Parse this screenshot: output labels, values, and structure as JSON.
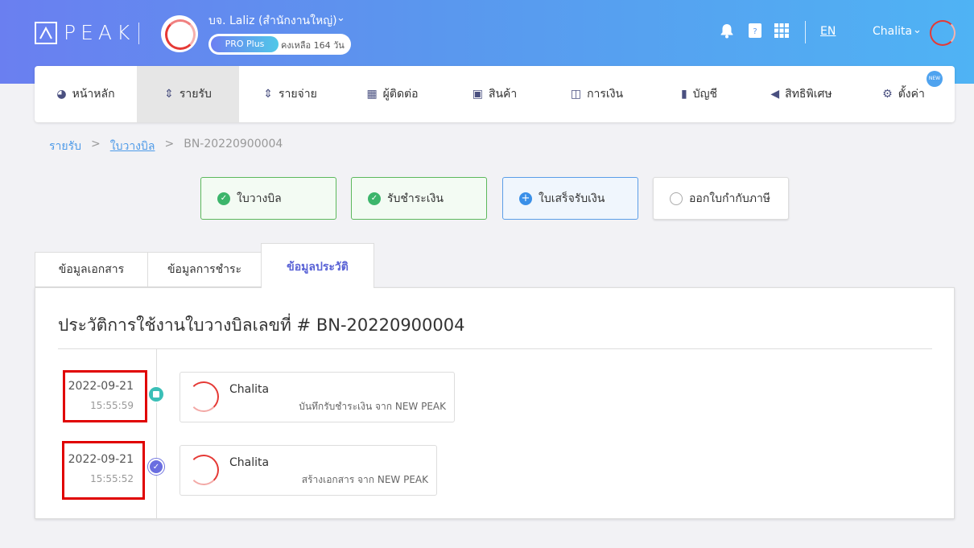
{
  "brand": {
    "logo_text": "PEAK"
  },
  "company": {
    "name": "บจ. Laliz (สำนักงานใหญ่)",
    "plan": "PRO Plus",
    "remaining": "คงเหลือ 164 วัน"
  },
  "header": {
    "language": "EN",
    "user_name": "Chalita"
  },
  "icons": {
    "notification": "bell-icon",
    "help": "book-icon",
    "apps": "grid-icon",
    "chevron": "chevron-down-icon"
  },
  "nav": {
    "items": [
      {
        "label": "หน้าหลัก",
        "icon": "dashboard-icon"
      },
      {
        "label": "รายรับ",
        "icon": "income-icon",
        "active": true
      },
      {
        "label": "รายจ่าย",
        "icon": "expense-icon"
      },
      {
        "label": "ผู้ติดต่อ",
        "icon": "building-icon"
      },
      {
        "label": "สินค้า",
        "icon": "box-icon"
      },
      {
        "label": "การเงิน",
        "icon": "money-icon"
      },
      {
        "label": "บัญชี",
        "icon": "ledger-icon"
      },
      {
        "label": "สิทธิพิเศษ",
        "icon": "megaphone-icon"
      },
      {
        "label": "ตั้งค่า",
        "icon": "gear-icon"
      }
    ],
    "new_badge": "NEW"
  },
  "breadcrumb": {
    "items": [
      "รายรับ",
      "ใบวางบิล",
      "BN-20220900004"
    ],
    "separator": ">"
  },
  "workflow": {
    "steps": [
      {
        "label": "ใบวางบิล",
        "status": "done"
      },
      {
        "label": "รับชำระเงิน",
        "status": "done"
      },
      {
        "label": "ใบเสร็จรับเงิน",
        "status": "current"
      },
      {
        "label": "ออกใบกำกับภาษี",
        "status": "todo"
      }
    ]
  },
  "tabs": [
    {
      "label": "ข้อมูลเอกสาร"
    },
    {
      "label": "ข้อมูลการชำระ"
    },
    {
      "label": "ข้อมูลประวัติ",
      "active": true
    }
  ],
  "history": {
    "title": "ประวัติการใช้งานใบวางบิลเลขที่ # BN-20220900004",
    "entries": [
      {
        "date": "2022-09-21",
        "time": "15:55:59",
        "user": "Chalita",
        "action": "บันทึกรับชำระเงิน จาก NEW PEAK",
        "marker": "teal"
      },
      {
        "date": "2022-09-21",
        "time": "15:55:52",
        "user": "Chalita",
        "action": "สร้างเอกสาร จาก NEW PEAK",
        "marker": "purple"
      }
    ]
  },
  "colors": {
    "brand_gradient_start": "#6a7ff0",
    "brand_gradient_end": "#4fb3f4",
    "active_tab": "#5a63d6",
    "link": "#4d9ae8",
    "highlight": "#e00000"
  }
}
